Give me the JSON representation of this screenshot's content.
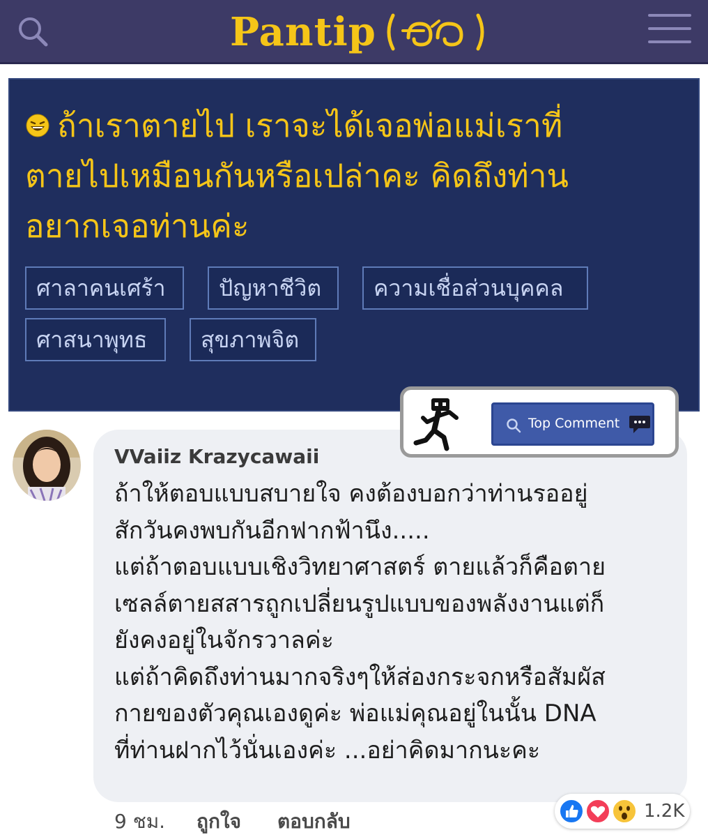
{
  "header": {
    "logo_text": "Pantip",
    "search_icon": "search-icon",
    "menu_icon": "hamburger-menu-icon",
    "bg_color": "#3d3a66",
    "logo_color": "#f5c518"
  },
  "topic": {
    "title_lines": [
      "ถ้าเราตายไป เราจะได้เจอพ่อแม่เราที่",
      "ตายไปเหมือนกันหรือเปล่าคะ คิดถึงท่าน",
      "อยากเจอท่านค่ะ"
    ],
    "title_icon": "laughing-emoji-icon",
    "bg_color": "#1f2e5e",
    "tags": [
      "ศาลาคนเศร้า",
      "ปัญหาชีวิต",
      "ความเชื่อส่วนบุคคล",
      "ศาสนาพุทธ",
      "สุขภาพจิต"
    ]
  },
  "badge": {
    "label": "Top Comment",
    "runner_icon": "running-robot-icon",
    "search_icon": "search-icon",
    "chat_icon": "chat-bubble-icon"
  },
  "comment": {
    "author": "VVaiiz Krazycawaii",
    "lines": [
      "ถ้าให้ตอบแบบสบายใจ คงต้องบอกว่าท่านรออยู่",
      "สักวันคงพบกันอีกฟากฟ้านึง.....",
      "แต่ถ้าตอบแบบเชิงวิทยาศาสตร์ ตายแล้วก็คือตาย",
      "เซลล์ตายสสารถูกเปลี่ยนรูปแบบของพลังงานแต่ก็",
      "ยังคงอยู่ในจักรวาลค่ะ",
      "แต่ถ้าคิดถึงท่านมากจริงๆให้ส่องกระจกหรือสัมผัส",
      "กายของตัวคุณเองดูค่ะ พ่อแม่คุณอยู่ในนั้น DNA",
      "ที่ท่านฝากไว้นั่นเองค่ะ ...อย่าคิดมากนะคะ"
    ],
    "time": "9 ชม.",
    "like_label": "ถูกใจ",
    "reply_label": "ตอบกลับ",
    "reaction_icons": [
      "like-icon",
      "love-icon",
      "wow-icon"
    ],
    "reaction_count": "1.2K"
  }
}
